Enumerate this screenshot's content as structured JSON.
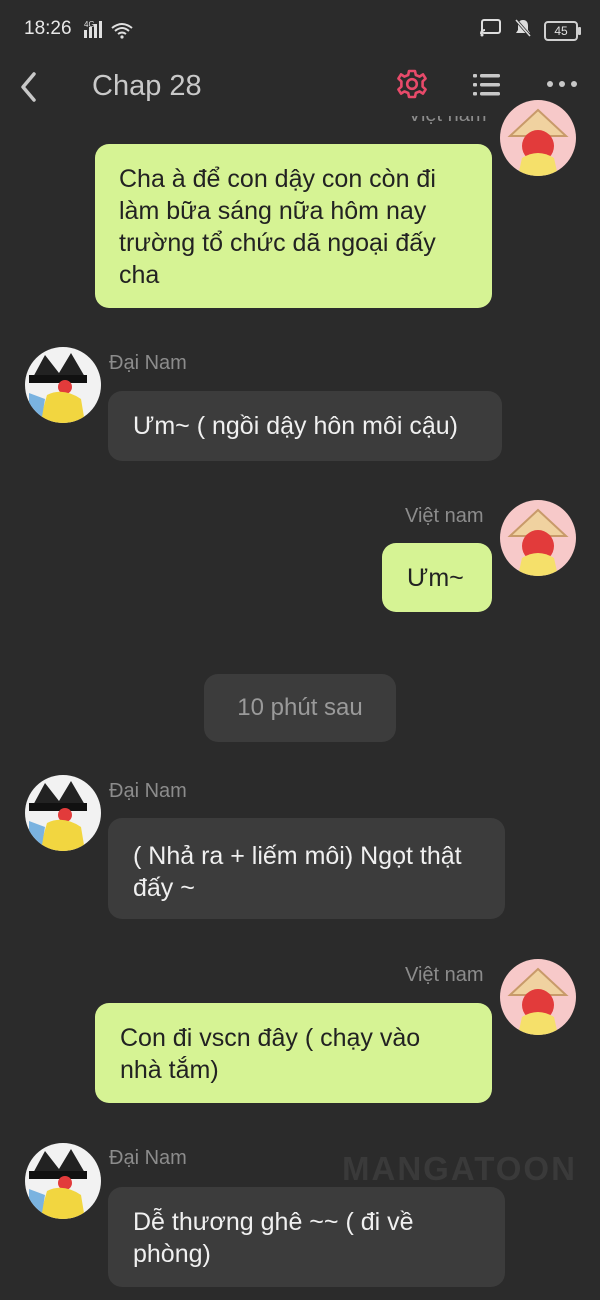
{
  "status": {
    "time": "18:26",
    "network": "4G",
    "battery": "45"
  },
  "header": {
    "title": "Chap 28"
  },
  "messages": [
    {
      "speaker": "Việt nam",
      "text": "Cha à để con dậy con còn đi làm bữa sáng nữa hôm nay trường tổ chức dã ngoại đấy cha"
    },
    {
      "speaker": "Đại Nam",
      "text": "Ưm~ ( ngồi dậy hôn môi cậu)"
    },
    {
      "speaker": "Việt nam",
      "text": "Ưm~"
    },
    {
      "divider": "10 phút sau"
    },
    {
      "speaker": "Đại Nam",
      "text": "( Nhả ra + liếm môi) Ngọt thật đấy ~"
    },
    {
      "speaker": "Việt nam",
      "text": "Con đi vscn đây ( chạy vào nhà tắm)"
    },
    {
      "speaker": "Đại Nam",
      "text": "Dễ thương ghê ~~ ( đi về phòng)"
    }
  ],
  "watermark": "MANGATOON",
  "colors": {
    "accent": "#e84a6a",
    "outgoing_bubble": "#d6f394",
    "incoming_bubble": "#3c3c3c",
    "background": "#2b2b2b"
  },
  "icons": [
    "back-arrow-icon",
    "gear-icon",
    "list-icon",
    "more-icon"
  ]
}
